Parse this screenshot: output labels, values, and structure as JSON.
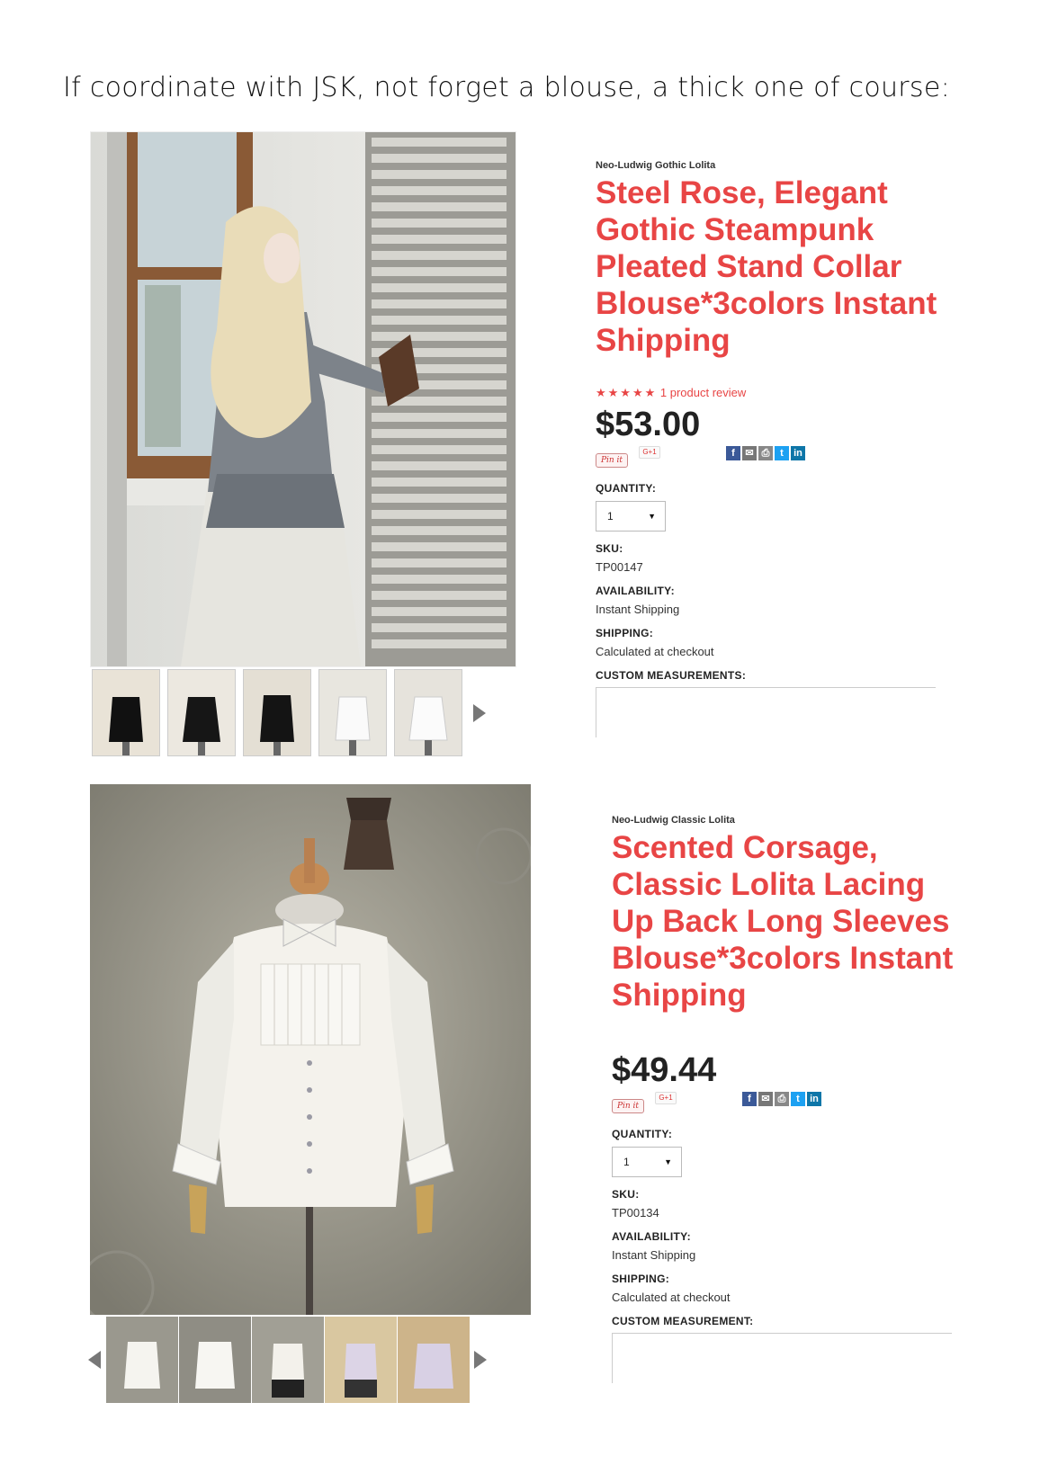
{
  "intro_text": "If coordinate with JSK, not forget a blouse, a thick one of course:",
  "products": [
    {
      "category": "Neo-Ludwig Gothic Lolita",
      "title": "Steel Rose, Elegant Gothic Steampunk Pleated Stand Collar Blouse*3colors Instant Shipping",
      "rating_stars": "★★★★★",
      "review_text": "1 product review",
      "price": "$53.00",
      "pinit_label": "Pin it",
      "gplus_label": "G+1",
      "quantity_label": "QUANTITY:",
      "quantity_value": "1",
      "sku_label": "SKU:",
      "sku_value": "TP00147",
      "availability_label": "AVAILABILITY:",
      "availability_value": "Instant Shipping",
      "shipping_label": "SHIPPING:",
      "shipping_value": "Calculated at checkout",
      "custom_label": "CUSTOM MEASUREMENTS:",
      "thumbnails": [
        "black blouse",
        "black blouse",
        "black blouse",
        "white blouse",
        "white blouse"
      ]
    },
    {
      "category": "Neo-Ludwig Classic Lolita",
      "title": "Scented Corsage, Classic Lolita Lacing Up Back Long Sleeves Blouse*3colors Instant Shipping",
      "price": "$49.44",
      "pinit_label": "Pin it",
      "gplus_label": "G+1",
      "quantity_label": "QUANTITY:",
      "quantity_value": "1",
      "sku_label": "SKU:",
      "sku_value": "TP00134",
      "availability_label": "AVAILABILITY:",
      "availability_value": "Instant Shipping",
      "shipping_label": "SHIPPING:",
      "shipping_value": "Calculated at checkout",
      "custom_label": "CUSTOM MEASUREMENT:",
      "thumbnails": [
        "white blouse",
        "white blouse",
        "white blouse",
        "lavender blouse",
        "lavender blouse"
      ]
    }
  ],
  "social_icons": [
    "facebook-icon",
    "mail-icon",
    "print-icon",
    "twitter-icon",
    "linkedin-icon"
  ],
  "colors": {
    "title_red": "#e84545",
    "facebook": "#3b5998",
    "twitter": "#1da1f2",
    "linkedin": "#0e76a8"
  }
}
